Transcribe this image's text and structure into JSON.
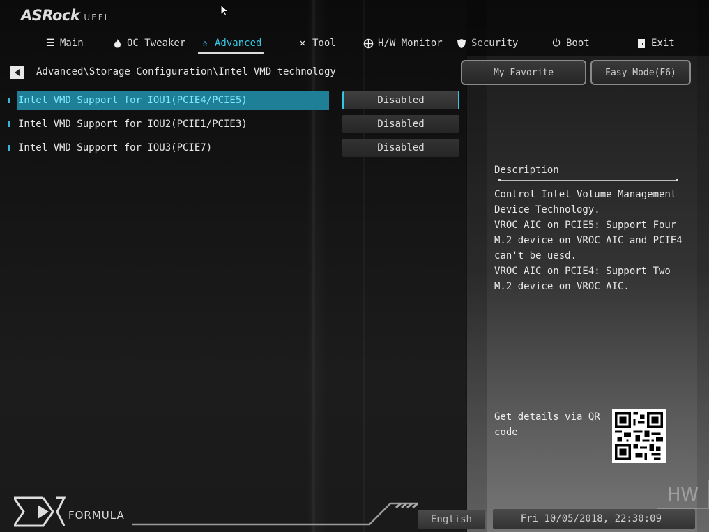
{
  "brand": {
    "logo": "ASRock",
    "sub": "UEFI"
  },
  "nav": {
    "tabs": [
      {
        "label": "Main",
        "icon": "list-icon"
      },
      {
        "label": "OC Tweaker",
        "icon": "flame-icon"
      },
      {
        "label": "Advanced",
        "icon": "star-icon"
      },
      {
        "label": "Tool",
        "icon": "tools-icon"
      },
      {
        "label": "H/W Monitor",
        "icon": "crosshair-icon"
      },
      {
        "label": "Security",
        "icon": "shield-icon"
      },
      {
        "label": "Boot",
        "icon": "power-icon"
      },
      {
        "label": "Exit",
        "icon": "door-icon"
      }
    ],
    "active_tab": "Advanced"
  },
  "breadcrumb": "Advanced\\Storage Configuration\\Intel VMD technology",
  "buttons": {
    "favorite": "My Favorite",
    "easy_mode": "Easy Mode(F6)"
  },
  "settings": [
    {
      "label": "Intel VMD Support for IOU1(PCIE4/PCIE5)",
      "value": "Disabled",
      "selected": true
    },
    {
      "label": "Intel VMD Support for IOU2(PCIE1/PCIE3)",
      "value": "Disabled",
      "selected": false
    },
    {
      "label": "Intel VMD Support for IOU3(PCIE7)",
      "value": "Disabled",
      "selected": false
    }
  ],
  "description": {
    "title": "Description",
    "text": "Control Intel Volume Management\nDevice Technology.\nVROC AIC on PCIE5: Support Four\nM.2 device on VROC AIC and PCIE4\ncan't be uesd.\nVROC AIC on PCIE4: Support Two\nM.2 device on VROC AIC."
  },
  "qr": {
    "text": "Get details via QR code"
  },
  "footer": {
    "brand_text": "FORMULA",
    "language": "English",
    "datetime": "Fri 10/05/2018, 22:30:09",
    "watermark": "HW"
  },
  "colors": {
    "accent": "#38c8e6",
    "selected_row": "#1f7f97",
    "selected_text": "#7fe9ff"
  }
}
